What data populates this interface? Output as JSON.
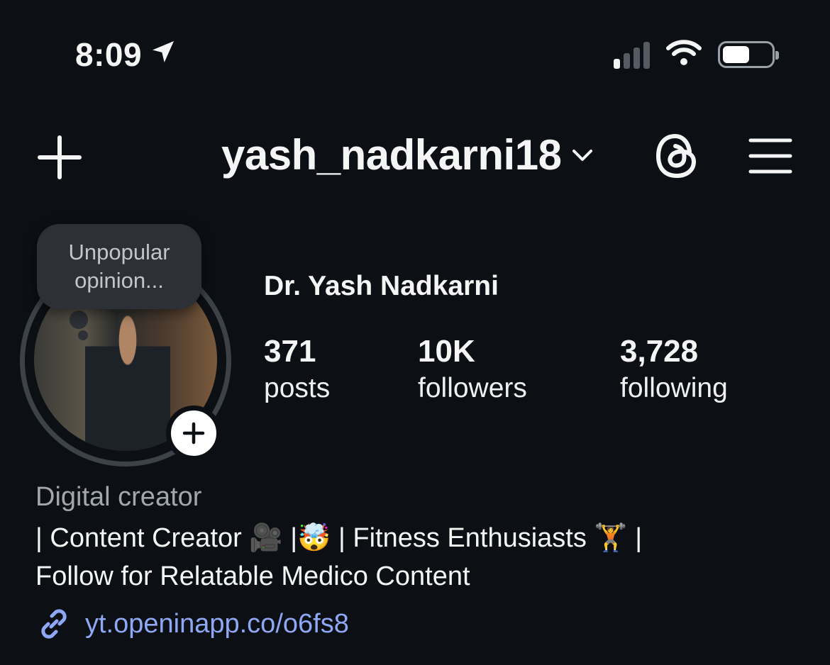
{
  "status_bar": {
    "time": "8:09",
    "icons": [
      "location-arrow-icon",
      "cellular-signal-icon",
      "wifi-icon",
      "battery-icon"
    ]
  },
  "header": {
    "username": "yash_nadkarni18",
    "icons": [
      "plus-icon",
      "chevron-down-icon",
      "threads-icon",
      "hamburger-menu-icon"
    ]
  },
  "profile": {
    "note": "Unpopular opinion...",
    "full_name": "Dr. Yash Nadkarni",
    "stats": [
      {
        "value": "371",
        "label": "posts"
      },
      {
        "value": "10K",
        "label": "followers"
      },
      {
        "value": "3,728",
        "label": "following"
      }
    ],
    "category": "Digital creator",
    "bio_line1": "| Content Creator 🎥 |🤯 | Fitness Enthusiasts 🏋️ |",
    "bio_line2": "Follow for Relatable Medico Content",
    "link": "yt.openinapp.co/o6fs8"
  },
  "colors": {
    "background": "#0c0f14",
    "text": "#f5f5f5",
    "muted": "#a2a7ae",
    "link": "#8fa8f5",
    "note_bubble": "#2d3036"
  }
}
